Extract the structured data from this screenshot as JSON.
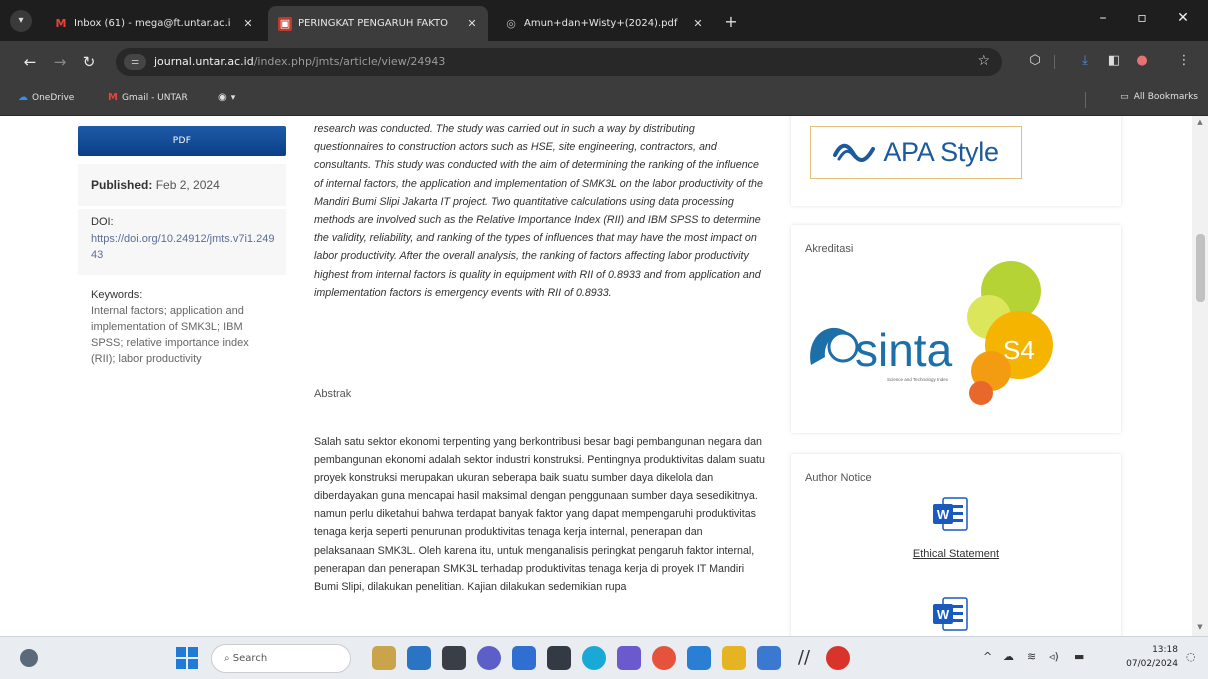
{
  "tabs": [
    {
      "title": "Inbox (61) - mega@ft.untar.ac.i",
      "icon": "gmail-icon"
    },
    {
      "title": "PERINGKAT PENGARUH FAKTO",
      "icon": "journal-icon",
      "active": true
    },
    {
      "title": "Amun+dan+Wisty+(2024).pdf",
      "icon": "pdf-icon"
    }
  ],
  "address": {
    "host": "journal.untar.ac.id",
    "path": "/index.php/jmts/article/view/24943"
  },
  "bookmarks": {
    "items": [
      "OneDrive",
      "Gmail - UNTAR"
    ],
    "all": "All Bookmarks"
  },
  "sidebar": {
    "pdf_label": "PDF",
    "published_label": "Published:",
    "published_date": "Feb 2, 2024",
    "doi_label": "DOI:",
    "doi_url": "https://doi.org/10.24912/jmts.v7i1.24943",
    "keywords_label": "Keywords:",
    "keywords": "Internal factors; application and implementation of SMK3L; IBM SPSS; relative importance index (RII); labor productivity"
  },
  "article": {
    "abstract_en": "research was conducted. The study was carried out in such a way by distributing questionnaires to construction actors such as HSE, site engineering, contractors, and consultants. This study was conducted with the aim of determining the ranking of the influence of internal factors, the application and implementation of SMK3L on the labor productivity of the Mandiri Bumi Slipi Jakarta IT project. Two quantitative calculations using data processing methods are involved such as the Relative Importance Index (RII) and IBM SPSS to determine the validity, reliability, and ranking of the types of influences that may have the most impact on labor productivity. After the overall analysis, the ranking of factors affecting labor productivity highest from internal factors is quality in equipment with RII of 0.8933 and from application and implementation factors is emergency events with RII of 0.8933.",
    "abstrak_heading": "Abstrak",
    "abstrak_text": "Salah satu sektor ekonomi terpenting yang berkontribusi besar bagi pembangunan negara dan pembangunan ekonomi adalah sektor industri konstruksi. Pentingnya produktivitas dalam suatu proyek konstruksi merupakan ukuran seberapa baik suatu sumber daya dikelola dan diberdayakan guna mencapai hasil maksimal dengan penggunaan sumber daya sesedikitnya. namun perlu diketahui bahwa terdapat banyak faktor yang dapat mempengaruhi produktivitas tenaga kerja seperti penurunan produktivitas tenaga kerja internal, penerapan dan pelaksanaan SMK3L. Oleh karena itu, untuk menganalisis peringkat pengaruh faktor internal, penerapan dan penerapan SMK3L terhadap produktivitas tenaga kerja di proyek IT Mandiri Bumi Slipi, dilakukan penelitian. Kajian dilakukan sedemikian rupa"
  },
  "right_sidebar": {
    "apa_text": "APA Style",
    "akreditasi_title": "Akreditasi",
    "sinta_word": "sinta",
    "sinta_level": "S4",
    "sinta_tagline": "Science and Technology Index",
    "author_notice_title": "Author Notice",
    "word_icon_letter": "W",
    "ethical_statement": "Ethical Statement"
  },
  "taskbar": {
    "search_placeholder": "Search",
    "time": "13:18",
    "date": "07/02/2024"
  },
  "colors": {
    "pdf_button": "#0b3f86",
    "apa_blue": "#1c5a9c",
    "sinta_blue": "#1d6fa8",
    "sinta_orange": "#f39c12",
    "sinta_green": "#b5d334",
    "word_blue": "#185abd"
  }
}
